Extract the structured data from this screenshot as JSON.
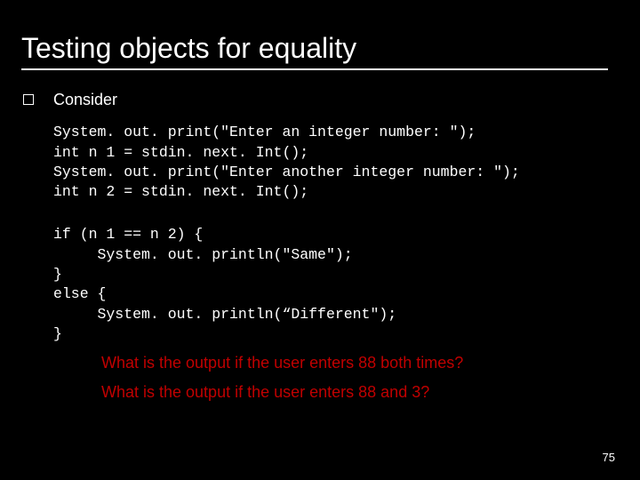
{
  "title": "Testing objects for equality",
  "lead_word": "Consider",
  "code1_line1": "System. out. print(\"Enter an integer number: \");",
  "code1_line2": "int n 1 = stdin. next. Int();",
  "code1_line3": "System. out. print(\"Enter another integer number: \");",
  "code1_line4": "int n 2 = stdin. next. Int();",
  "code2_line1": "if (n 1 == n 2) {",
  "code2_line2": "     System. out. println(\"Same\");",
  "code2_line3": "}",
  "code2_line4": "else {",
  "code2_line5": "     System. out. println(“Different\");",
  "code2_line6": "}",
  "question1": "What is the output if the user enters 88 both times?",
  "question2": "What is the output if the user enters 88 and 3?",
  "slide_number": "75"
}
